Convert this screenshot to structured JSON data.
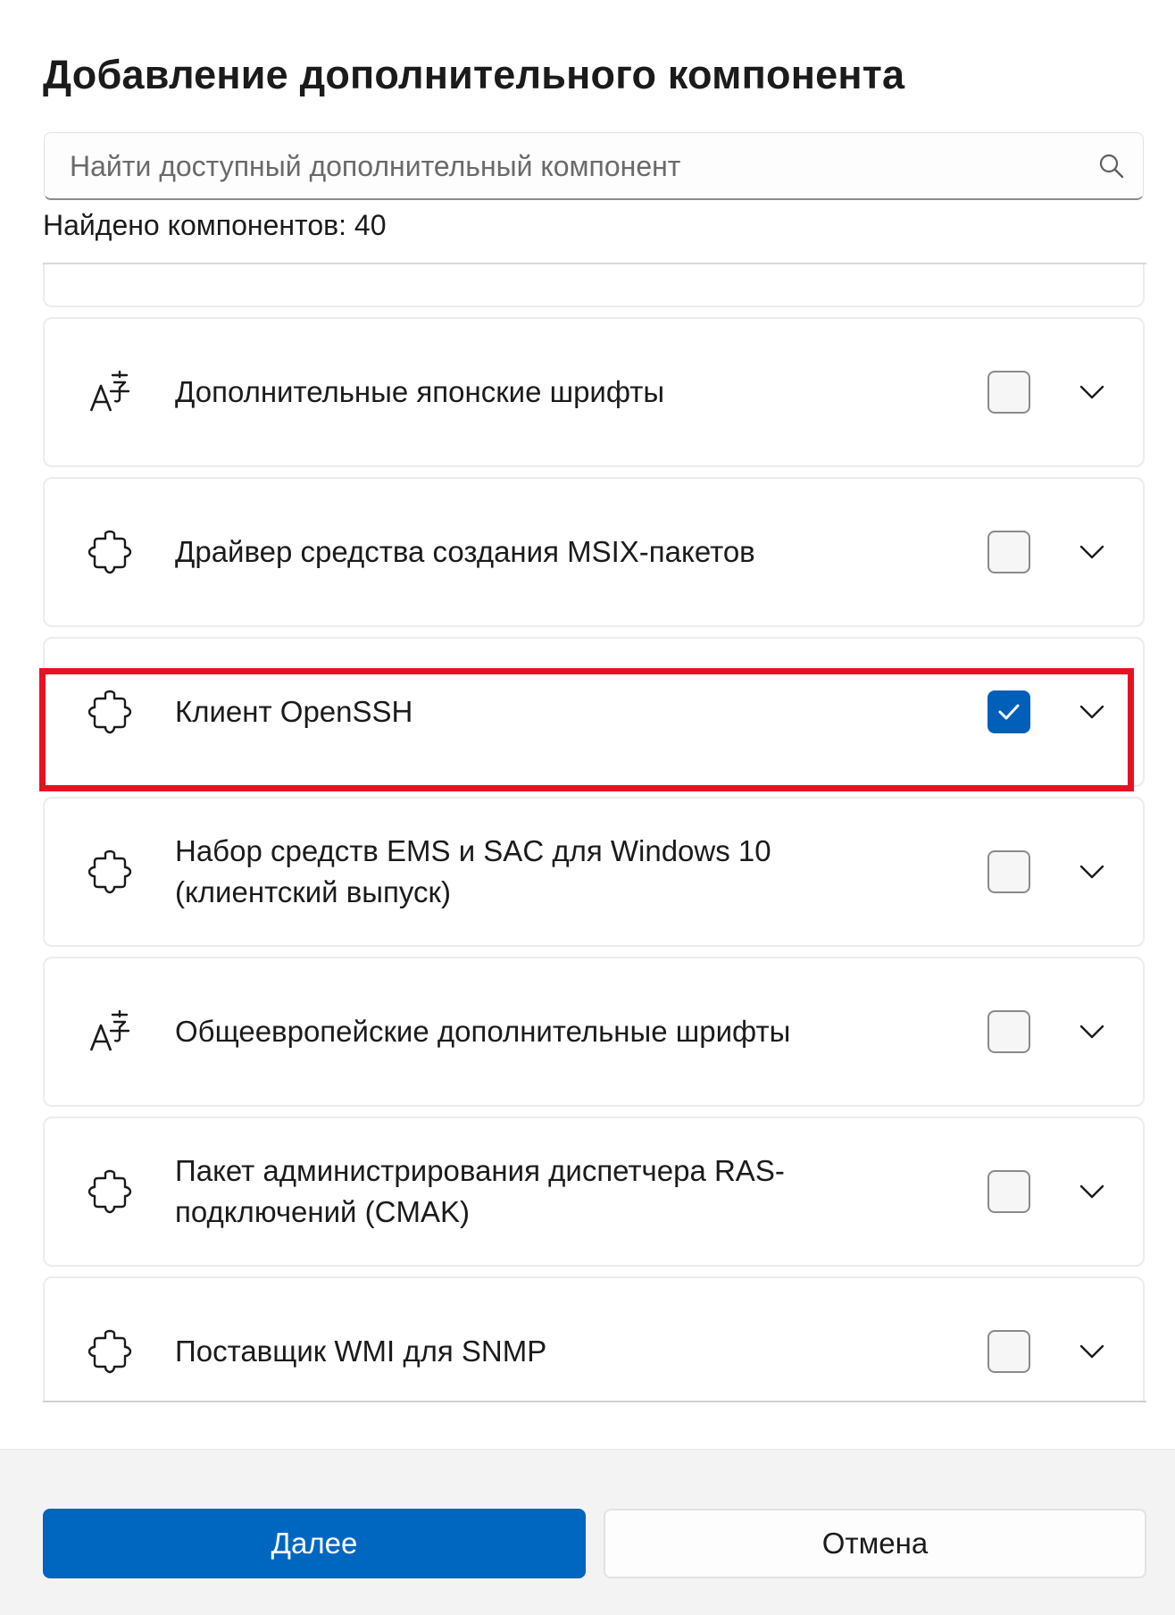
{
  "dialog": {
    "title": "Добавление дополнительного компонента",
    "search": {
      "placeholder": "Найти доступный дополнительный компонент",
      "value": ""
    },
    "count_label": "Найдено компонентов: 40"
  },
  "features": [
    {
      "label": "",
      "icon": "puzzle-icon",
      "checked": false
    },
    {
      "label": "Дополнительные японские шрифты",
      "icon": "font-icon",
      "checked": false
    },
    {
      "label": "Драйвер средства создания MSIX-пакетов",
      "icon": "puzzle-icon",
      "checked": false
    },
    {
      "label": "Клиент OpenSSH",
      "icon": "puzzle-icon",
      "checked": true
    },
    {
      "label": "Набор средств EMS и SAC для Windows 10 (клиентский выпуск)",
      "icon": "puzzle-icon",
      "checked": false
    },
    {
      "label": "Общеевропейские дополнительные шрифты",
      "icon": "font-icon",
      "checked": false
    },
    {
      "label": "Пакет администрирования диспетчера RAS-подключений (CMAK)",
      "icon": "puzzle-icon",
      "checked": false
    },
    {
      "label": "Поставщик WMI для SNMP",
      "icon": "puzzle-icon",
      "checked": false
    }
  ],
  "footer": {
    "next_label": "Далее",
    "cancel_label": "Отмена"
  },
  "colors": {
    "accent": "#0067c0",
    "highlight": "#e81123"
  }
}
